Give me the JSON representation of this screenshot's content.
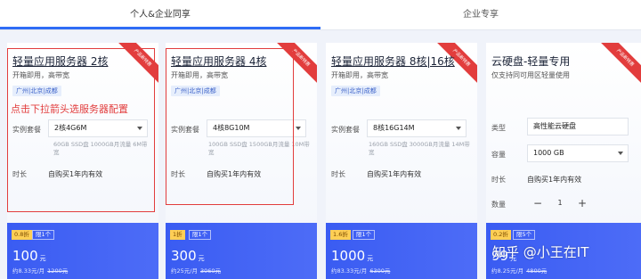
{
  "tabs": [
    {
      "label": "个人&企业同享",
      "active": true
    },
    {
      "label": "企业专享",
      "active": false
    }
  ],
  "annotation": "点击下拉箭头选服务器配置",
  "ribbon_text": "产品新特惠",
  "cards": [
    {
      "title": "轻量应用服务器 2核",
      "subtitle": "开箱即用，高带宽",
      "region": "广州|北京|成都",
      "spec_label": "实例套餐",
      "spec_value": "2核4G6M",
      "spec_note": "60GB SSD盘 1000GB月流量 6M带宽",
      "duration_label": "时长",
      "duration_value": "自购买1年内有效",
      "discount": "0.8折",
      "limit": "限1个",
      "price": "100",
      "unit": "元",
      "monthly": "约8.33元/月",
      "original": "1200元"
    },
    {
      "title": "轻量应用服务器 4核",
      "subtitle": "开箱即用，高带宽",
      "region": "广州|北京|成都",
      "spec_label": "实例套餐",
      "spec_value": "4核8G10M",
      "spec_note": "100GB SSD盘 1500GB月流量 10M带宽",
      "duration_label": "时长",
      "duration_value": "自购买1年内有效",
      "discount": "1折",
      "limit": "限1个",
      "price": "300",
      "unit": "元",
      "monthly": "约25元/月",
      "original": "3060元"
    },
    {
      "title": "轻量应用服务器 8核|16核",
      "subtitle": "开箱即用，高带宽",
      "region": "广州|北京|成都",
      "spec_label": "实例套餐",
      "spec_value": "8核16G14M",
      "spec_note": "160GB SSD盘 3000GB月流量 14M带宽",
      "duration_label": "时长",
      "duration_value": "自购买1年内有效",
      "discount": "1.6折",
      "limit": "限1个",
      "price": "1000",
      "unit": "元",
      "monthly": "约83.33元/月",
      "original": "6300元"
    },
    {
      "title": "云硬盘-轻量专用",
      "subtitle": "仅支持同可用区轻量使用",
      "type_label": "类型",
      "type_value": "高性能云硬盘",
      "capacity_label": "容量",
      "capacity_value": "1000 GB",
      "duration_label": "时长",
      "duration_value": "自购买1年内有效",
      "qty_label": "数量",
      "qty_minus": "−",
      "qty_value": "1",
      "qty_plus": "+",
      "discount": "0.2折",
      "limit": "限5个",
      "price": "99",
      "unit": "元",
      "monthly": "约8.25元/月",
      "original": "4800元"
    }
  ],
  "watermark": "知乎 @小王在IT"
}
